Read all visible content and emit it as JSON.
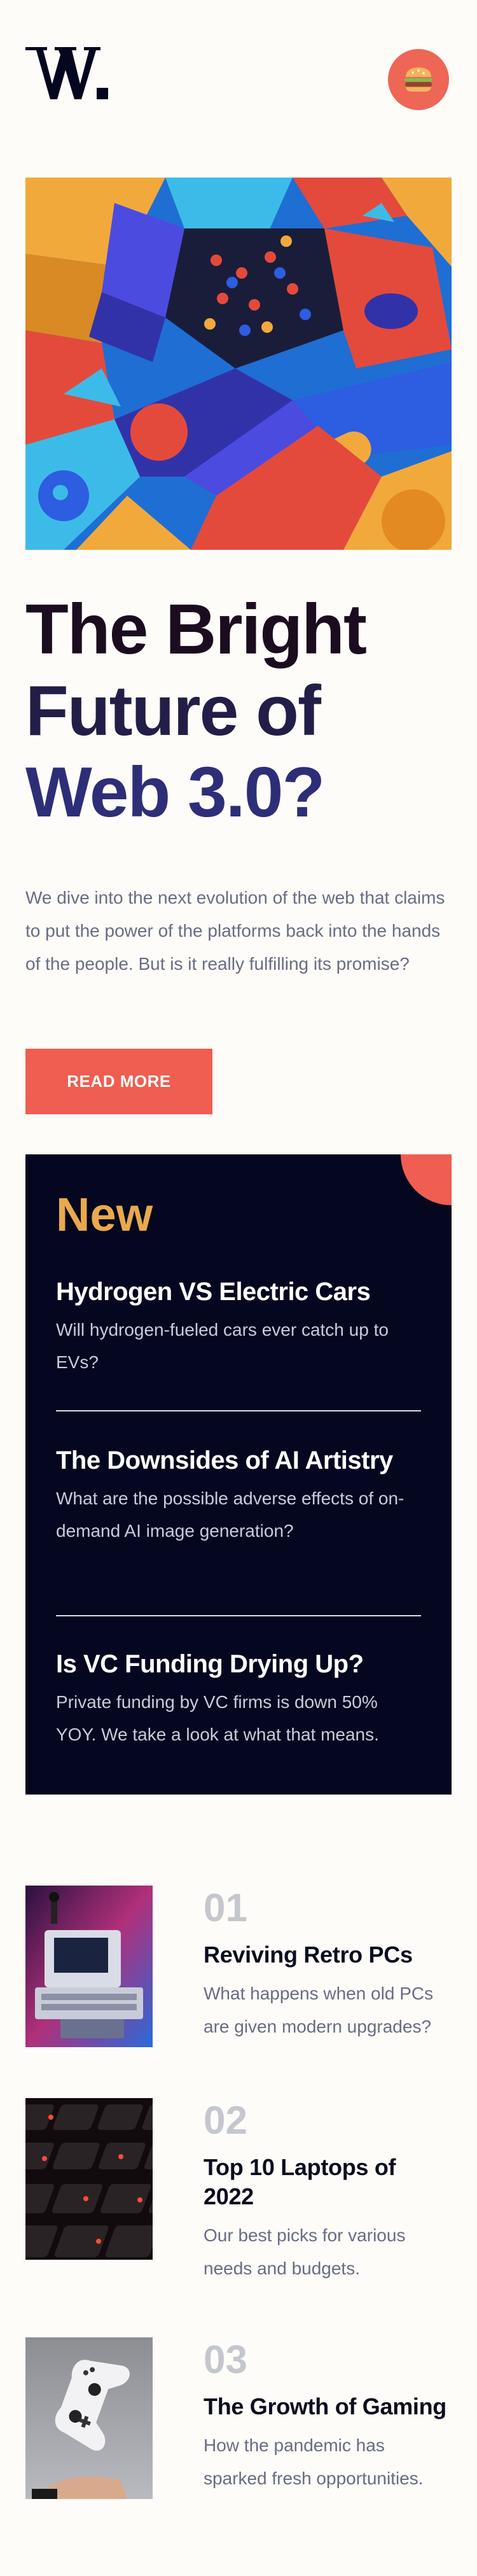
{
  "header": {
    "logo_text": "W.",
    "menu_icon": "burger-icon"
  },
  "hero": {
    "title_line1": "The Bright",
    "title_line2": "Future of",
    "title_line3": "Web 3.0?",
    "description": "We dive into the next evolution of the web that claims to put the power of the platforms back into the hands of the people. But is it really fulfilling its promise?",
    "button_label": "Read more"
  },
  "new_panel": {
    "heading": "New",
    "items": [
      {
        "title": "Hydrogen VS Electric Cars",
        "text": "Will hydrogen-fueled cars ever catch up to EVs?"
      },
      {
        "title": "The Downsides of AI Artistry",
        "text": "What are the possible adverse effects of on-demand AI image generation?"
      },
      {
        "title": "Is VC Funding Drying Up?",
        "text": "Private funding by VC firms is down 50% YOY. We take a look at what that means."
      }
    ]
  },
  "numbered": [
    {
      "num": "01",
      "title": "Reviving Retro PCs",
      "text": "What happens when old PCs are given modern upgrades?"
    },
    {
      "num": "02",
      "title": "Top 10 Laptops of 2022",
      "text": "Our best picks for various needs and budgets."
    },
    {
      "num": "03",
      "title": "The Growth of Gaming",
      "text": "How the pandemic has sparked fresh opportunities."
    }
  ],
  "colors": {
    "background": "#fdfcf8",
    "accent_red": "#ef5e50",
    "accent_gold": "#e9a94c",
    "dark_panel": "#05061f",
    "heading_navy": "#2e2e78"
  }
}
